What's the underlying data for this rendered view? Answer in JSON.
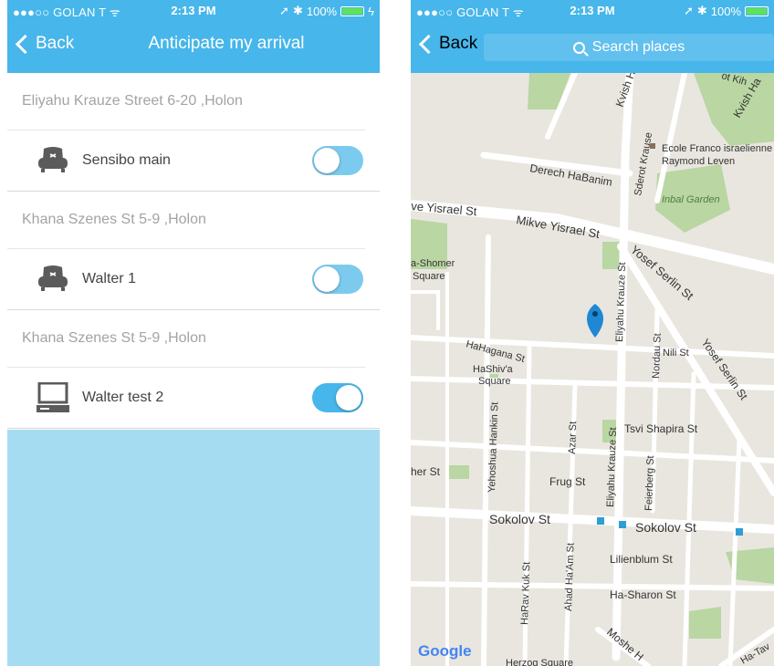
{
  "left": {
    "status": {
      "carrier": "●●●○○ GOLAN T ᯤ",
      "time": "2:13 PM",
      "battery": "100%"
    },
    "nav": {
      "back_label": "Back",
      "title": "Anticipate my arrival"
    },
    "groups": [
      {
        "address": "Eliyahu Krauze Street 6-20 ,Holon",
        "device": "Sensibo main",
        "icon": "sofa-icon",
        "toggle_on": false
      },
      {
        "address": "Khana Szenes St 5-9 ,Holon",
        "device": "Walter 1",
        "icon": "sofa-icon",
        "toggle_on": false
      },
      {
        "address": "Khana Szenes St 5-9 ,Holon",
        "device": "Walter test 2",
        "icon": "computer-icon",
        "toggle_on": true
      }
    ]
  },
  "right": {
    "status": {
      "carrier": "●●●○○ GOLAN T ᯤ",
      "time": "2:13 PM",
      "battery": "100%"
    },
    "nav": {
      "back_label": "Back",
      "search_placeholder": "Search places"
    },
    "map": {
      "labels": {
        "kvish_ha_1": "Kvish Ha",
        "kvish_ha_2": "Kvish Ha",
        "ecole_1": "Ecole Franco israelienne",
        "ecole_2": "Raymond Leven",
        "inbal": "Inbal Garden",
        "derech": "Derech HaBanim",
        "mikve_left": "ve Yisrael St",
        "mikve": "Mikve Yisrael St",
        "sderot": "Sderot Krause",
        "yosef_serlin_1": "Yosef Serlin St",
        "yosef_serlin_2": "Yosef Serlin St",
        "shomer_1": "a-Shomer",
        "shomer_2": "Square",
        "hahagana": "HaHagana St",
        "hashiva_1": "HaShiv'a",
        "hashiva_2": "Square",
        "eliyahu_1": "Eliyahu Krauze St",
        "eliyahu_2": "Eliyahu Krauze St",
        "nordau": "Nordau St",
        "nili": "Nili St",
        "hankin": "Yehoshua Hankin St",
        "azar": "Azar St",
        "tsvi": "Tsvi Shapira St",
        "her": "her St",
        "frug": "Frug St",
        "feierberg": "Feierberg St",
        "sokolov_1": "Sokolov St",
        "sokolov_2": "Sokolov St",
        "lilienblum": "Lilienblum St",
        "ahad": "Ahad Ha'Am St",
        "harav": "HaRav Kuk St",
        "hasharon": "Ha-Sharon St",
        "moshe": "Moshe H",
        "herzog": "Herzog Square",
        "kih": "ot Kih",
        "hatav": "Ha-Tav"
      },
      "attribution": "Google",
      "colors": {
        "road": "#ffffff",
        "park": "#b9d6a3",
        "land": "#e9e6df",
        "pin": "#1e88d4"
      }
    }
  },
  "colors": {
    "accent": "#47b6ea",
    "empty_area": "#a6dcf2",
    "toggle_on": "#47b6ea"
  }
}
